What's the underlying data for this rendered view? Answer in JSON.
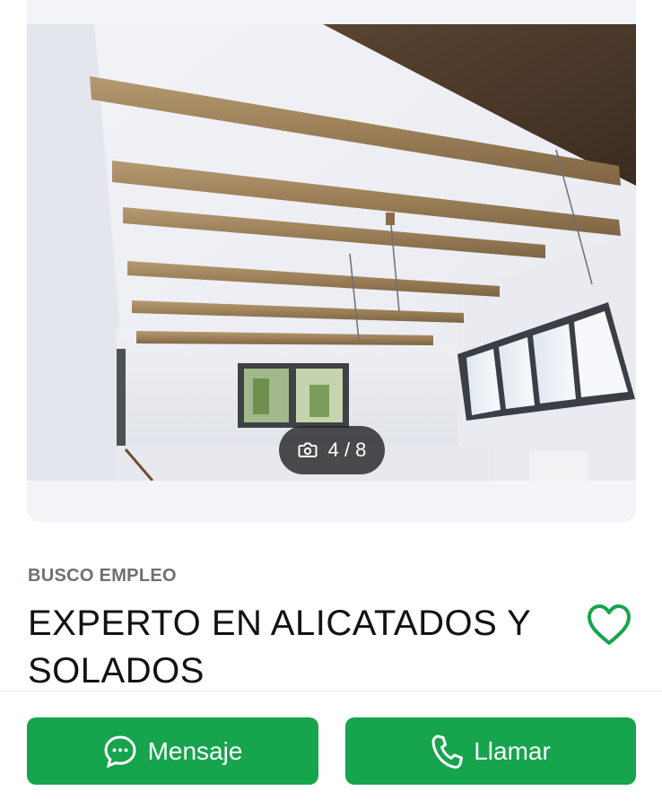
{
  "gallery": {
    "photo_alt": "",
    "counter": "4 / 8",
    "camera_icon": "camera-icon"
  },
  "listing": {
    "category": "BUSCO EMPLEO",
    "title": "EXPERTO EN ALICATADOS Y SOLADOS",
    "favorite_icon": "heart-outline-icon"
  },
  "actions": {
    "message_label": "Mensaje",
    "message_icon": "chat-bubble-icon",
    "call_label": "Llamar",
    "call_icon": "phone-icon"
  },
  "colors": {
    "accent": "#16a44d",
    "text": "#111214",
    "muted": "#6b7075"
  }
}
